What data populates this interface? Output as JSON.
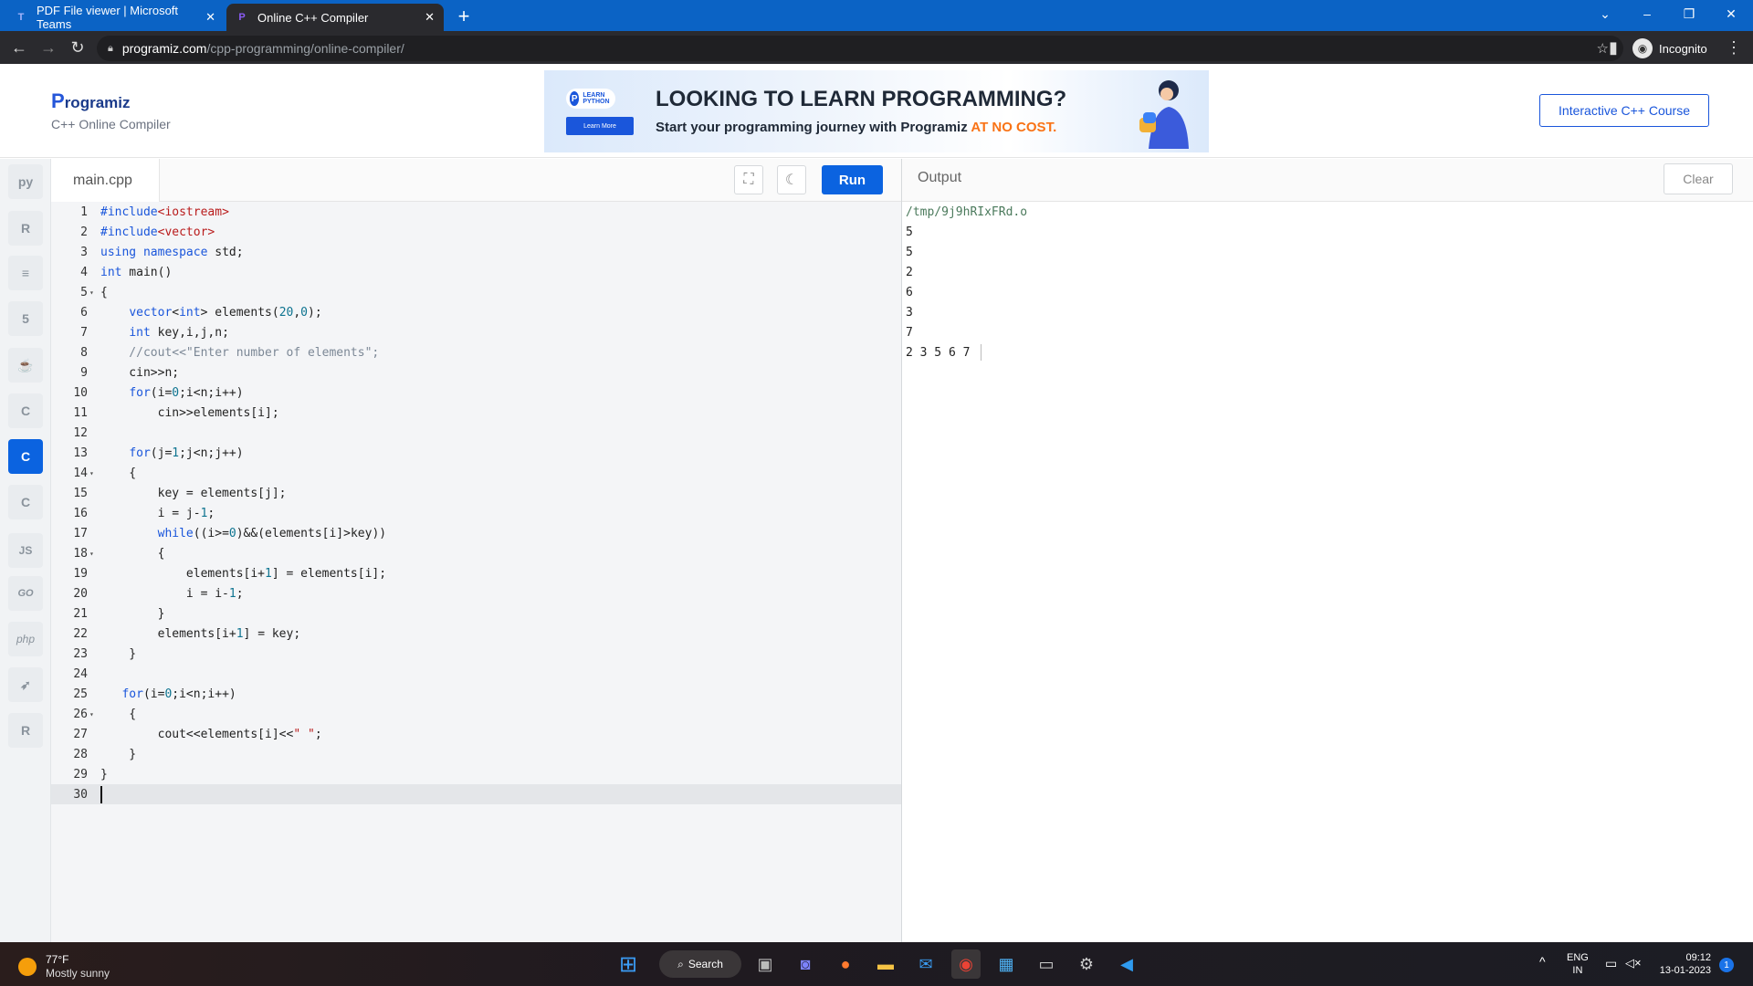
{
  "browser": {
    "tabs": [
      {
        "title": "PDF File viewer | Microsoft Teams",
        "icon": "teams-icon",
        "active": false
      },
      {
        "title": "Online C++ Compiler",
        "icon": "programiz-icon",
        "active": true
      }
    ],
    "url_host": "programiz.com",
    "url_path": "/cpp-programming/online-compiler/",
    "profile_label": "Incognito"
  },
  "header": {
    "logo": "Programiz",
    "logo_first": "P",
    "logo_rest": "rogramiz",
    "subtitle": "C++ Online Compiler",
    "course_button": "Interactive C++ Course"
  },
  "banner": {
    "badge": "LEARN PYTHON",
    "learn_more": "Learn More",
    "headline": "LOOKING TO LEARN PROGRAMMING?",
    "sub": "Start your programming journey with Programiz",
    "highlight": "AT NO COST."
  },
  "sidebar": {
    "items": [
      {
        "name": "python",
        "glyph": "py",
        "active": false
      },
      {
        "name": "r",
        "glyph": "R",
        "active": false
      },
      {
        "name": "sql",
        "glyph": "≡",
        "active": false
      },
      {
        "name": "html",
        "glyph": "5",
        "active": false
      },
      {
        "name": "java",
        "glyph": "☕",
        "active": false
      },
      {
        "name": "c",
        "glyph": "C",
        "active": false
      },
      {
        "name": "cpp",
        "glyph": "C",
        "active": true
      },
      {
        "name": "csharp",
        "glyph": "C",
        "active": false
      },
      {
        "name": "javascript",
        "glyph": "JS",
        "active": false
      },
      {
        "name": "go",
        "glyph": "GO",
        "active": false
      },
      {
        "name": "php",
        "glyph": "php",
        "active": false
      },
      {
        "name": "swift",
        "glyph": "➶",
        "active": false
      },
      {
        "name": "rust",
        "glyph": "R",
        "active": false
      }
    ]
  },
  "editor": {
    "filename": "main.cpp",
    "run_label": "Run",
    "lines": [
      "#include<iostream>",
      "#include<vector>",
      "using namespace std;",
      "int main()",
      "{",
      "    vector<int> elements(20,0);",
      "    int key,i,j,n;",
      "    //cout<<\"Enter number of elements\";",
      "    cin>>n;",
      "    for(i=0;i<n;i++)",
      "        cin>>elements[i];",
      "",
      "    for(j=1;j<n;j++)",
      "    {",
      "        key = elements[j];",
      "        i = j-1;",
      "        while((i>=0)&&(elements[i]>key))",
      "        {",
      "            elements[i+1] = elements[i];",
      "            i = i-1;",
      "        }",
      "        elements[i+1] = key;",
      "    }",
      "",
      "   for(i=0;i<n;i++)",
      "    {",
      "        cout<<elements[i]<<\" \";",
      "    }",
      "}",
      ""
    ],
    "fold_lines": [
      5,
      14,
      18,
      26
    ],
    "active_line": 30
  },
  "output": {
    "label": "Output",
    "clear_label": "Clear",
    "lines": [
      "/tmp/9j9hRIxFRd.o",
      "5",
      "5",
      "2",
      "6",
      "3",
      "7",
      "2 3 5 6 7 "
    ]
  },
  "taskbar": {
    "weather_temp": "77°F",
    "weather_desc": "Mostly sunny",
    "search_label": "Search",
    "lang_top": "ENG",
    "lang_bottom": "IN",
    "time": "09:12",
    "date": "13-01-2023",
    "notifications": "1"
  }
}
